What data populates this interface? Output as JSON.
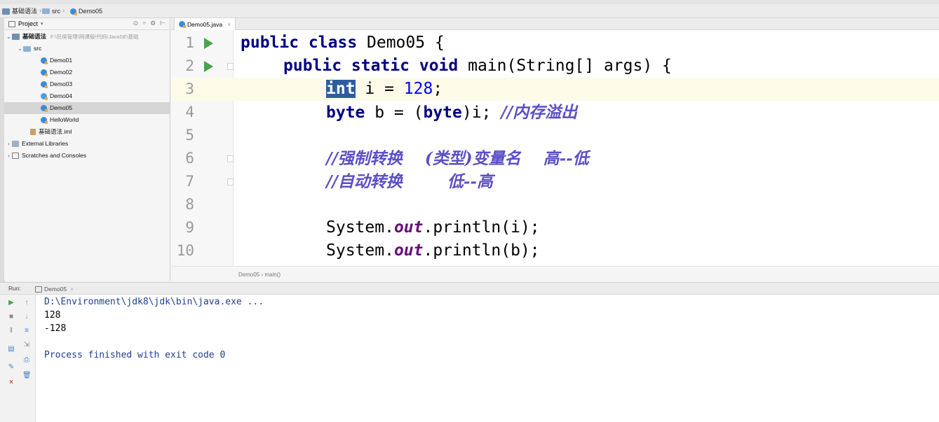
{
  "breadcrumb": {
    "project": "基础语法",
    "folder": "src",
    "file": "Demo05"
  },
  "project_panel": {
    "title": "Project",
    "tree": [
      {
        "label": "基础语法",
        "path": "F:\\狂侯管理\\网课版\\代码\\JavaSE\\基础",
        "icon": "module-icon",
        "level": 0,
        "expanded": true
      },
      {
        "label": "src",
        "icon": "folder-icon",
        "level": 1,
        "expanded": true
      },
      {
        "label": "Demo01",
        "icon": "java-class-icon",
        "level": 2
      },
      {
        "label": "Demo02",
        "icon": "java-class-icon",
        "level": 2
      },
      {
        "label": "Demo03",
        "icon": "java-class-icon",
        "level": 2
      },
      {
        "label": "Demo04",
        "icon": "java-class-icon",
        "level": 2
      },
      {
        "label": "Demo05",
        "icon": "java-class-icon",
        "level": 2,
        "selected": true
      },
      {
        "label": "HelloWorld",
        "icon": "java-class-icon",
        "level": 2
      },
      {
        "label": "基础语法.iml",
        "icon": "iml-file-icon",
        "level": 1
      },
      {
        "label": "External Libraries",
        "icon": "library-icon",
        "level": 0,
        "expanded": false
      },
      {
        "label": "Scratches and Consoles",
        "icon": "scratch-icon",
        "level": 0,
        "expanded": false
      }
    ]
  },
  "editor": {
    "tab_label": "Demo05.java",
    "breadcrumb": "Demo05 › main()",
    "line_numbers": [
      "1",
      "2",
      "3",
      "4",
      "5",
      "6",
      "7",
      "8",
      "9",
      "10"
    ],
    "lines": {
      "l1": {
        "kw": "public class",
        "rest": " Demo05 {"
      },
      "l2": {
        "kw": "public static void",
        "rest": " main(String[] args) {"
      },
      "l3": {
        "sel": "int",
        "rest1": " i = ",
        "num": "128",
        "rest2": ";"
      },
      "l4": {
        "kw1": "byte",
        "rest1": " b = (",
        "kw2": "byte",
        "rest2": ")i; ",
        "comment": "//内存溢出"
      },
      "l6": {
        "comment": "//强制转换    (类型)变量名    高--低"
      },
      "l7": {
        "comment": "//自动转换        低--高"
      },
      "l9": {
        "pre": "System.",
        "field": "out",
        "post": ".println(i);"
      },
      "l10": {
        "pre": "System.",
        "field": "out",
        "post": ".println(b);"
      }
    }
  },
  "run_panel": {
    "label": "Run:",
    "tab_label": "Demo05",
    "output": [
      "D:\\Environment\\jdk8\\jdk\\bin\\java.exe ...",
      "128",
      "-128",
      "",
      "Process finished with exit code 0"
    ]
  },
  "colors": {
    "keyword": "#000080",
    "number": "#0000ff",
    "comment": "#5b4fc6",
    "static_field": "#660e7a",
    "selection": "#2f5c9e",
    "run_green": "#49a34a"
  }
}
